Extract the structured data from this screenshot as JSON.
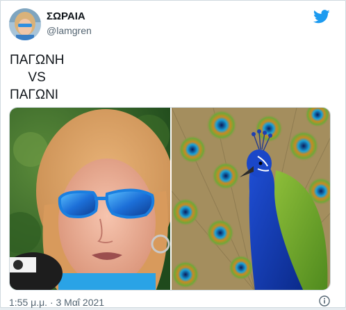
{
  "author": {
    "display_name": "ΣΩΡΑΙΑ",
    "handle": "@lamgren"
  },
  "tweet": {
    "line1": "ΠΑΓΩΝΗ",
    "line2": "     VS",
    "line3": "ΠΑΓΩΝΙ",
    "timestamp": "1:55 μ.μ. · 3 Μαΐ 2021"
  },
  "colors": {
    "twitter_blue": "#1d9bf0",
    "text": "#0f1419",
    "secondary": "#536471"
  },
  "icons": {
    "logo": "twitter-bird-icon",
    "info": "info-icon"
  }
}
